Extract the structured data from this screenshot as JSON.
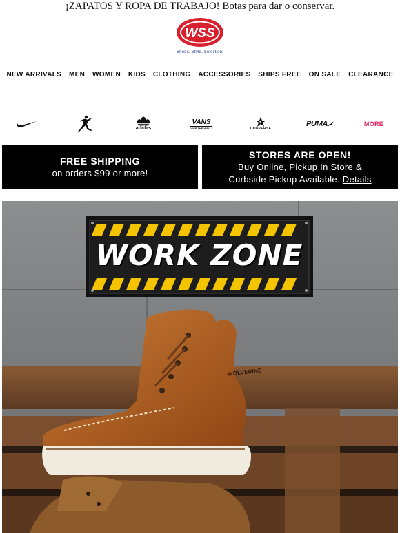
{
  "preheader": "¡ZAPATOS Y ROPA DE TRABAJO! Botas para dar o conservar.",
  "logo": {
    "text": "WSS",
    "tagline": "Shoes. Style. Selection."
  },
  "nav": [
    {
      "label": "NEW ARRIVALS"
    },
    {
      "label": "MEN"
    },
    {
      "label": "WOMEN"
    },
    {
      "label": "KIDS"
    },
    {
      "label": "CLOTHING"
    },
    {
      "label": "ACCESSORIES"
    },
    {
      "label": "SHIPS FREE"
    },
    {
      "label": "ON SALE"
    },
    {
      "label": "CLEARANCE"
    }
  ],
  "brands": {
    "nike": "nike-icon",
    "jordan": "jordan-icon",
    "adidas_label": "adidas",
    "vans_label": "VANS",
    "vans_sub": "\"OFF THE WALL\"",
    "converse_label": "CONVERSE",
    "puma_label": "PUMA",
    "more_label": "MORE"
  },
  "banners": {
    "left": {
      "title": "FREE SHIPPING",
      "subtitle": "on orders $99 or more!"
    },
    "right": {
      "title": "STORES ARE OPEN!",
      "line1": "Buy Online, Pickup In Store &",
      "line2": "Curbside Pickup Available.",
      "link": "Details"
    }
  },
  "hero": {
    "headline": "WORK ZONE",
    "boot_brand": "WOLVERINE"
  },
  "colors": {
    "brand_red": "#d8202e",
    "more_pink": "#e0245e",
    "banner_black": "#000000",
    "hazard_yellow": "#f5c400",
    "leather": "#b5611f"
  }
}
